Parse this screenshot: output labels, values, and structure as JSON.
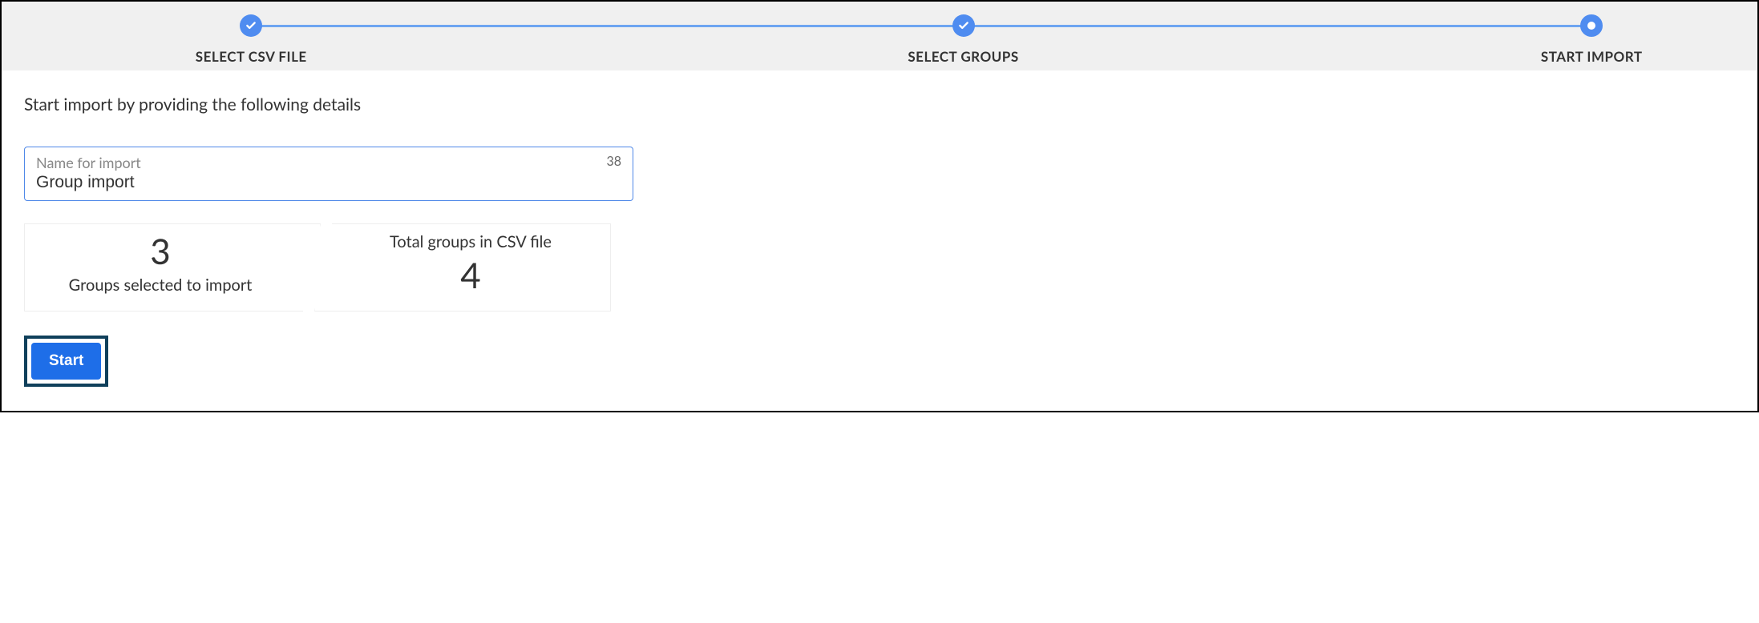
{
  "stepper": {
    "steps": [
      {
        "label": "SELECT CSV FILE",
        "status": "done"
      },
      {
        "label": "SELECT GROUPS",
        "status": "done"
      },
      {
        "label": "START IMPORT",
        "status": "current"
      }
    ]
  },
  "content": {
    "instruction": "Start import by providing the following details",
    "input": {
      "label": "Name for import",
      "value": "Group import",
      "counter": "38"
    },
    "stats": {
      "selected": {
        "number": "3",
        "label": "Groups selected to import"
      },
      "total": {
        "number": "4",
        "label": "Total groups in CSV file"
      }
    },
    "start_button": "Start"
  }
}
